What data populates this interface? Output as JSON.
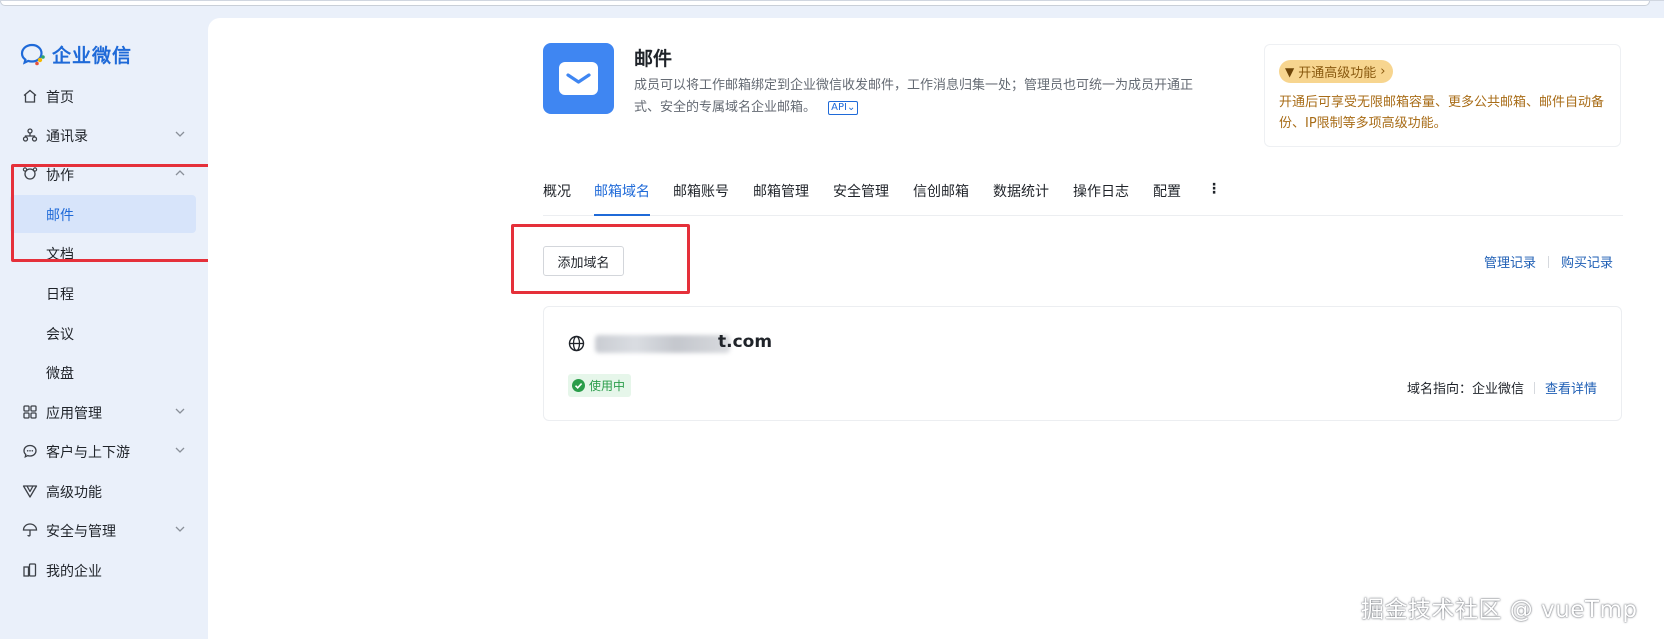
{
  "app": {
    "logo_text": "企业微信"
  },
  "sidebar": {
    "items": [
      {
        "label": "首页",
        "icon": "home-icon"
      },
      {
        "label": "通讯录",
        "icon": "contacts-icon",
        "expandable": true
      },
      {
        "label": "协作",
        "icon": "collab-icon",
        "expandable": true,
        "expanded": true
      },
      {
        "label": "邮件",
        "sub": true,
        "active": true
      },
      {
        "label": "文档",
        "sub": true
      },
      {
        "label": "日程",
        "sub": true
      },
      {
        "label": "会议",
        "sub": true
      },
      {
        "label": "微盘",
        "sub": true
      },
      {
        "label": "应用管理",
        "icon": "apps-icon",
        "expandable": true
      },
      {
        "label": "客户与上下游",
        "icon": "chat-icon",
        "expandable": true
      },
      {
        "label": "高级功能",
        "icon": "vip-icon"
      },
      {
        "label": "安全与管理",
        "icon": "umbrella-icon",
        "expandable": true
      },
      {
        "label": "我的企业",
        "icon": "building-icon"
      }
    ]
  },
  "header": {
    "title": "邮件",
    "desc_line1": "成员可以将工作邮箱绑定到企业微信收发邮件，工作消息归集一处；管理员也可统一为成员开通正",
    "desc_line2": "式、安全的专属域名企业邮箱。",
    "api_badge": "API"
  },
  "promo": {
    "badge": "开通高级功能",
    "text": "开通后可享受无限邮箱容量、更多公共邮箱、邮件自动备份、IP限制等多项高级功能。"
  },
  "tabs": [
    {
      "label": "概况"
    },
    {
      "label": "邮箱域名",
      "active": true
    },
    {
      "label": "邮箱账号"
    },
    {
      "label": "邮箱管理"
    },
    {
      "label": "安全管理"
    },
    {
      "label": "信创邮箱"
    },
    {
      "label": "数据统计"
    },
    {
      "label": "操作日志"
    },
    {
      "label": "配置"
    },
    {
      "label": "⋮"
    }
  ],
  "toolbar": {
    "add_domain": "添加域名",
    "manage_records": "管理记录",
    "purchase_records": "购买记录"
  },
  "domain_card": {
    "domain_visible": "t.com",
    "status": "使用中",
    "pointer_label": "域名指向：",
    "pointer_value": "企业微信",
    "details_link": "查看详情"
  },
  "watermark": "掘金技术社区 @ vueTmp",
  "colors": {
    "accent": "#1f6ad8",
    "highlight_box": "#e5303a",
    "status_green": "#2a9d4a",
    "promo_gold": "#f7d58f"
  }
}
